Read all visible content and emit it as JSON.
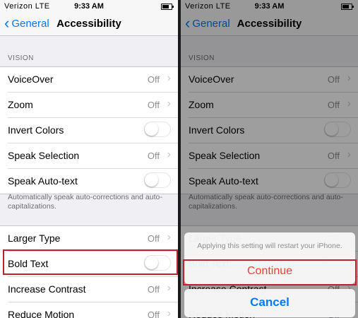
{
  "status": {
    "carrier": "Verizon",
    "network": "LTE",
    "time": "9:33 AM"
  },
  "nav": {
    "back_label": "General",
    "title": "Accessibility"
  },
  "vision": {
    "header": "VISION",
    "rows": [
      {
        "label": "VoiceOver",
        "value": "Off"
      },
      {
        "label": "Zoom",
        "value": "Off"
      },
      {
        "label": "Invert Colors"
      },
      {
        "label": "Speak Selection",
        "value": "Off"
      },
      {
        "label": "Speak Auto-text"
      }
    ],
    "footnote": "Automatically speak auto-corrections and auto-capitalizations."
  },
  "display": {
    "rows": [
      {
        "label": "Larger Type",
        "value": "Off"
      },
      {
        "label": "Bold Text"
      },
      {
        "label": "Increase Contrast",
        "value": "Off"
      },
      {
        "label": "Reduce Motion",
        "value": "Off"
      }
    ]
  },
  "alert": {
    "message": "Applying this setting will restart your iPhone.",
    "continue_label": "Continue",
    "cancel_label": "Cancel"
  },
  "icons": [
    "back-chevron-icon",
    "disclosure-chevron-icon",
    "battery-icon",
    "toggle-switch"
  ],
  "colors": {
    "accent": "#007aff",
    "destructive": "#ff3b30",
    "highlight": "#c0202a"
  }
}
